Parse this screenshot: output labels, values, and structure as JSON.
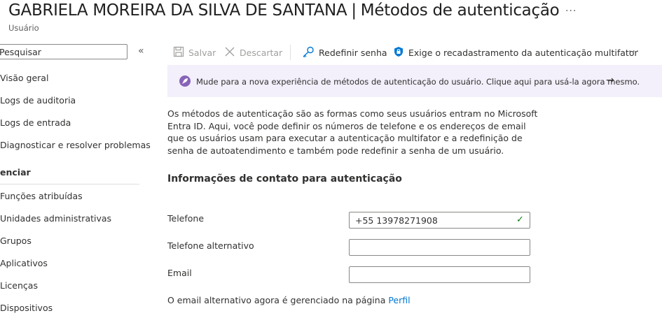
{
  "header": {
    "user_name": "GABRIELA MOREIRA DA SILVA DE SANTANA",
    "separator": "|",
    "page_title": "Métodos de autenticação",
    "more": "···",
    "subtitle": "Usuário"
  },
  "sidebar": {
    "search_placeholder": "Pesquisar",
    "collapse": "«",
    "items_top": [
      {
        "label": "Visão geral"
      },
      {
        "label": "Logs de auditoria"
      },
      {
        "label": "Logs de entrada"
      },
      {
        "label": "Diagnosticar e resolver problemas"
      }
    ],
    "section_label": "enciar",
    "items_bottom": [
      {
        "label": "Funções atribuídas"
      },
      {
        "label": "Unidades administrativas"
      },
      {
        "label": "Grupos"
      },
      {
        "label": "Aplicativos"
      },
      {
        "label": "Licenças"
      },
      {
        "label": "Dispositivos"
      }
    ]
  },
  "toolbar": {
    "save_label": "Salvar",
    "discard_label": "Descartar",
    "reset_password_label": "Redefinir senha",
    "require_mfa_label": "Exige o recadastramento da autenticação multifator",
    "more": "···",
    "icons": {
      "save": "save-icon",
      "discard": "close-icon",
      "reset": "key-icon",
      "mfa": "shield-lock-icon"
    }
  },
  "banner": {
    "text": "Mude para a nova experiência de métodos de autenticação do usuário. Clique aqui para usá-la agora mesmo.",
    "arrow": "→",
    "icon": "rocket-icon",
    "background": "#f3effb",
    "icon_color": "#8764b8"
  },
  "description": "Os métodos de autenticação são as formas como seus usuários entram no Microsoft Entra ID. Aqui, você pode definir os números de telefone e os endereços de email que os usuários usam para executar a autenticação multifator e a redefinição de senha de autoatendimento e também pode redefinir a senha de um usuário.",
  "contact": {
    "section_title": "Informações de contato para autenticação",
    "phone_label": "Telefone",
    "phone_value": "+55 13978271908",
    "alt_phone_label": "Telefone alternativo",
    "alt_phone_value": "",
    "email_label": "Email",
    "email_value": "",
    "valid_check": "✓",
    "note_prefix": "O email alternativo agora é gerenciado na página ",
    "note_link": "Perfil"
  },
  "colors": {
    "accent": "#0078d4",
    "success": "#107c10",
    "disabled": "#a19f9d"
  }
}
